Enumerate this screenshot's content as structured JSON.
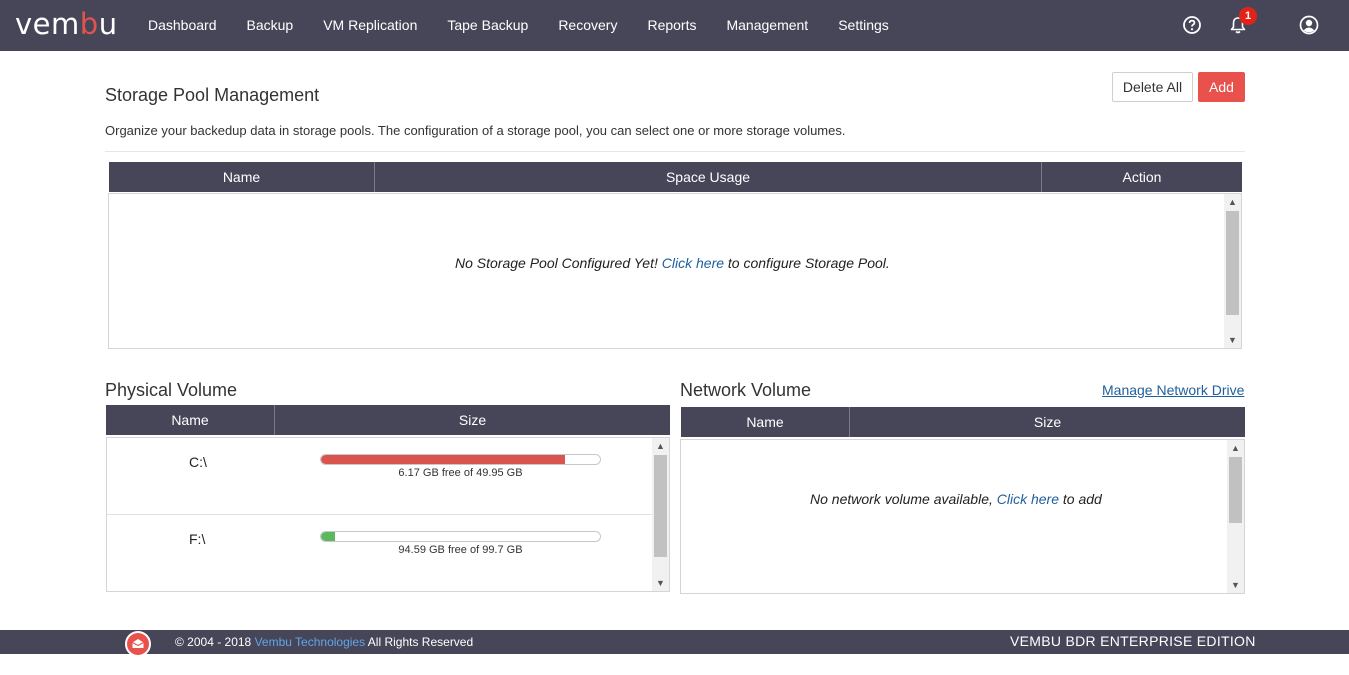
{
  "brand": {
    "logo_prefix": "vem",
    "logo_accent": "b",
    "logo_suffix": "u",
    "accent_color": "#e9514d",
    "nav_color": "#474659"
  },
  "nav": {
    "items": [
      "Dashboard",
      "Backup",
      "VM Replication",
      "Tape Backup",
      "Recovery",
      "Reports",
      "Management",
      "Settings"
    ],
    "notification_count": "1",
    "icons": [
      "help-icon",
      "bell-icon",
      "user-icon"
    ]
  },
  "page": {
    "title": "Storage Pool Management",
    "description": "Organize your backedup data in storage pools. The configuration of a storage pool, you can select one or more storage volumes.",
    "delete_all_label": "Delete All",
    "add_label": "Add"
  },
  "pool_table": {
    "headers": [
      "Name",
      "Space Usage",
      "Action"
    ],
    "empty_prefix": "No Storage Pool Configured Yet! ",
    "empty_link": "Click here",
    "empty_suffix": " to configure Storage Pool."
  },
  "physical": {
    "title": "Physical Volume",
    "headers": [
      "Name",
      "Size"
    ],
    "volumes": [
      {
        "name": "C:\\",
        "usage_text": "6.17 GB free of 49.95 GB",
        "used_fraction": 0.876,
        "color": "#d9534f"
      },
      {
        "name": "F:\\",
        "usage_text": "94.59 GB free of 99.7 GB",
        "used_fraction": 0.051,
        "color": "#5cb85c"
      }
    ]
  },
  "network": {
    "title": "Network Volume",
    "manage_link": "Manage Network Drive",
    "headers": [
      "Name",
      "Size"
    ],
    "empty_prefix": "No network volume available, ",
    "empty_link": "Click here",
    "empty_suffix": " to add"
  },
  "footer": {
    "copyright_prefix": "© 2004 - 2018 ",
    "company": "Vembu Technologies",
    "copyright_suffix": " All Rights Reserved",
    "edition": "VEMBU BDR ENTERPRISE EDITION"
  }
}
